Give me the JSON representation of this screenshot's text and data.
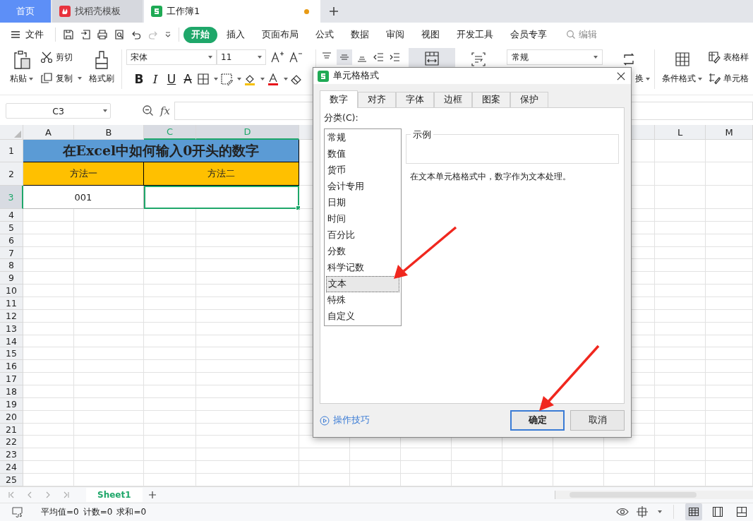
{
  "tabs": [
    {
      "label": "首页",
      "kind": "home",
      "selected": false
    },
    {
      "label": "找稻壳模板",
      "kind": "template",
      "selected": false
    },
    {
      "label": "工作簿1",
      "kind": "sheet",
      "selected": true,
      "unsaved": true
    }
  ],
  "menu": {
    "file": "文件",
    "tabs": [
      {
        "label": "开始",
        "selected": true
      },
      {
        "label": "插入",
        "selected": false
      },
      {
        "label": "页面布局",
        "selected": false
      },
      {
        "label": "公式",
        "selected": false
      },
      {
        "label": "数据",
        "selected": false
      },
      {
        "label": "审阅",
        "selected": false
      },
      {
        "label": "视图",
        "selected": false
      },
      {
        "label": "开发工具",
        "selected": false
      },
      {
        "label": "会员专享",
        "selected": false
      }
    ],
    "search": "编辑"
  },
  "ribbon": {
    "paste": "粘贴",
    "cut": "剪切",
    "copy": "复制",
    "format_painter": "格式刷",
    "font": "宋体",
    "font_size": "11",
    "bold": "B",
    "italic": "I",
    "underline": "U",
    "strike": "A",
    "number_format": "常规",
    "convert": "换",
    "conditional_format": "条件格式",
    "table_style": "表格样",
    "cell_style": "单元格"
  },
  "formula_bar": {
    "name_box": "C3",
    "fx": "fx"
  },
  "sheet": {
    "columns": [
      {
        "label": "A",
        "selected": false
      },
      {
        "label": "B",
        "selected": false
      },
      {
        "label": "C",
        "selected": true
      },
      {
        "label": "D",
        "selected": true
      }
    ],
    "right_columns": [
      {
        "label": "L",
        "selected": false
      },
      {
        "label": "M",
        "selected": false
      }
    ],
    "rows": [
      {
        "number": "1",
        "selected": false,
        "kind": "title",
        "cells": [
          {
            "text": "在Excel中如何输入0开头的数字",
            "selected": false
          }
        ]
      },
      {
        "number": "2",
        "selected": false,
        "kind": "header",
        "cells": [
          {
            "text": "方法一",
            "selected": false
          },
          {
            "text": "方法二",
            "selected": false
          }
        ]
      },
      {
        "number": "3",
        "selected": true,
        "kind": "data",
        "cells": [
          {
            "text": "001",
            "selected": false
          },
          {
            "selected": true
          }
        ]
      },
      {
        "number": "4",
        "selected": false
      },
      {
        "number": "5",
        "selected": false
      },
      {
        "number": "6",
        "selected": false
      },
      {
        "number": "7",
        "selected": false
      },
      {
        "number": "8",
        "selected": false
      },
      {
        "number": "9",
        "selected": false
      },
      {
        "number": "10",
        "selected": false
      },
      {
        "number": "11",
        "selected": false
      },
      {
        "number": "12",
        "selected": false
      },
      {
        "number": "13",
        "selected": false
      },
      {
        "number": "14",
        "selected": false
      },
      {
        "number": "15",
        "selected": false
      },
      {
        "number": "16",
        "selected": false
      },
      {
        "number": "17",
        "selected": false
      },
      {
        "number": "18",
        "selected": false
      },
      {
        "number": "19",
        "selected": false
      },
      {
        "number": "20",
        "selected": false
      },
      {
        "number": "21",
        "selected": false
      },
      {
        "number": "22",
        "selected": false
      },
      {
        "number": "23",
        "selected": false
      },
      {
        "number": "24",
        "selected": false
      },
      {
        "number": "25",
        "selected": false
      }
    ]
  },
  "sheet_tabs": [
    {
      "label": "Sheet1",
      "selected": true
    }
  ],
  "status_bar": {
    "average": "平均值=0",
    "count": "计数=0",
    "sum": "求和=0",
    "views": [
      {
        "kind": "normal",
        "selected": true
      },
      {
        "kind": "page",
        "selected": false
      },
      {
        "kind": "break",
        "selected": false
      }
    ]
  },
  "dialog": {
    "title": "单元格格式",
    "tabs": [
      {
        "label": "数字",
        "selected": true
      },
      {
        "label": "对齐",
        "selected": false
      },
      {
        "label": "字体",
        "selected": false
      },
      {
        "label": "边框",
        "selected": false
      },
      {
        "label": "图案",
        "selected": false
      },
      {
        "label": "保护",
        "selected": false
      }
    ],
    "category_label": "分类(C):",
    "categories": [
      {
        "label": "常规",
        "selected": false
      },
      {
        "label": "数值",
        "selected": false
      },
      {
        "label": "货币",
        "selected": false
      },
      {
        "label": "会计专用",
        "selected": false
      },
      {
        "label": "日期",
        "selected": false
      },
      {
        "label": "时间",
        "selected": false
      },
      {
        "label": "百分比",
        "selected": false
      },
      {
        "label": "分数",
        "selected": false
      },
      {
        "label": "科学记数",
        "selected": false
      },
      {
        "label": "文本",
        "selected": true
      },
      {
        "label": "特殊",
        "selected": false
      },
      {
        "label": "自定义",
        "selected": false
      }
    ],
    "sample_label": "示例",
    "description": "在文本单元格格式中，数字作为文本处理。",
    "tips_link": "操作技巧",
    "buttons": [
      {
        "label": "确定",
        "kind": "primary"
      },
      {
        "label": "取消",
        "kind": "secondary"
      }
    ]
  }
}
